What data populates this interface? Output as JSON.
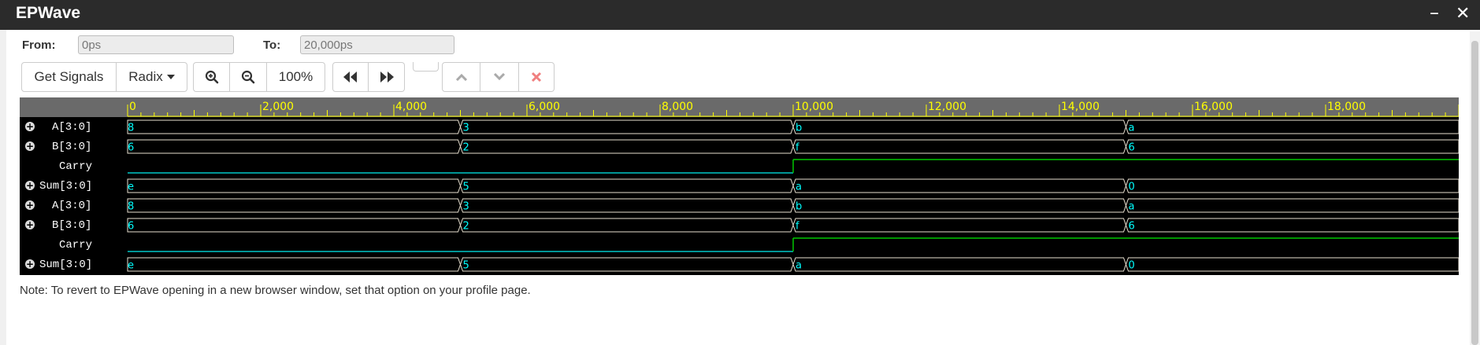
{
  "window": {
    "title": "EPWave"
  },
  "range": {
    "from_label": "From:",
    "from_value": "0ps",
    "to_label": "To:",
    "to_value": "20,000ps"
  },
  "toolbar": {
    "get_signals": "Get Signals",
    "radix": "Radix",
    "zoom_in_icon": "zoom-in-icon",
    "zoom_out_icon": "zoom-out-icon",
    "zoom_level": "100%",
    "rewind_icon": "rewind-icon",
    "fast_forward_icon": "fast-forward-icon",
    "up_icon": "chevron-up-icon",
    "down_icon": "chevron-down-icon",
    "delete_icon": "close-icon"
  },
  "timeline": {
    "start": 0,
    "end": 20000,
    "labels": [
      "0",
      "2,000",
      "4,000",
      "6,000",
      "8,000",
      "10,000",
      "12,000",
      "14,000",
      "16,000",
      "18,000"
    ],
    "label_values": [
      0,
      2000,
      4000,
      6000,
      8000,
      10000,
      12000,
      14000,
      16000,
      18000
    ]
  },
  "colors": {
    "ruler_text": "#ffff00",
    "bus": "#e8e0d0",
    "bus_text": "#00ffff",
    "bit_low": "#00c8c8",
    "bit_high": "#00c800"
  },
  "signals": [
    {
      "name": "A[3:0]",
      "type": "bus",
      "expandable": true,
      "segments": [
        {
          "t": 0,
          "v": "8"
        },
        {
          "t": 5000,
          "v": "3"
        },
        {
          "t": 10000,
          "v": "b"
        },
        {
          "t": 15000,
          "v": "a"
        }
      ]
    },
    {
      "name": "B[3:0]",
      "type": "bus",
      "expandable": true,
      "segments": [
        {
          "t": 0,
          "v": "6"
        },
        {
          "t": 5000,
          "v": "2"
        },
        {
          "t": 10000,
          "v": "f"
        },
        {
          "t": 15000,
          "v": "6"
        }
      ]
    },
    {
      "name": "Carry",
      "type": "bit",
      "expandable": false,
      "segments": [
        {
          "t": 0,
          "v": 0
        },
        {
          "t": 10000,
          "v": 1
        }
      ]
    },
    {
      "name": "Sum[3:0]",
      "type": "bus",
      "expandable": true,
      "segments": [
        {
          "t": 0,
          "v": "e"
        },
        {
          "t": 5000,
          "v": "5"
        },
        {
          "t": 10000,
          "v": "a"
        },
        {
          "t": 15000,
          "v": "0"
        }
      ]
    },
    {
      "name": "A[3:0]",
      "type": "bus",
      "expandable": true,
      "segments": [
        {
          "t": 0,
          "v": "8"
        },
        {
          "t": 5000,
          "v": "3"
        },
        {
          "t": 10000,
          "v": "b"
        },
        {
          "t": 15000,
          "v": "a"
        }
      ]
    },
    {
      "name": "B[3:0]",
      "type": "bus",
      "expandable": true,
      "segments": [
        {
          "t": 0,
          "v": "6"
        },
        {
          "t": 5000,
          "v": "2"
        },
        {
          "t": 10000,
          "v": "f"
        },
        {
          "t": 15000,
          "v": "6"
        }
      ]
    },
    {
      "name": "Carry",
      "type": "bit",
      "expandable": false,
      "segments": [
        {
          "t": 0,
          "v": 0
        },
        {
          "t": 10000,
          "v": 1
        }
      ]
    },
    {
      "name": "Sum[3:0]",
      "type": "bus",
      "expandable": true,
      "segments": [
        {
          "t": 0,
          "v": "e"
        },
        {
          "t": 5000,
          "v": "5"
        },
        {
          "t": 10000,
          "v": "a"
        },
        {
          "t": 15000,
          "v": "0"
        }
      ]
    }
  ],
  "note": "Note: To revert to EPWave opening in a new browser window, set that option on your profile page."
}
